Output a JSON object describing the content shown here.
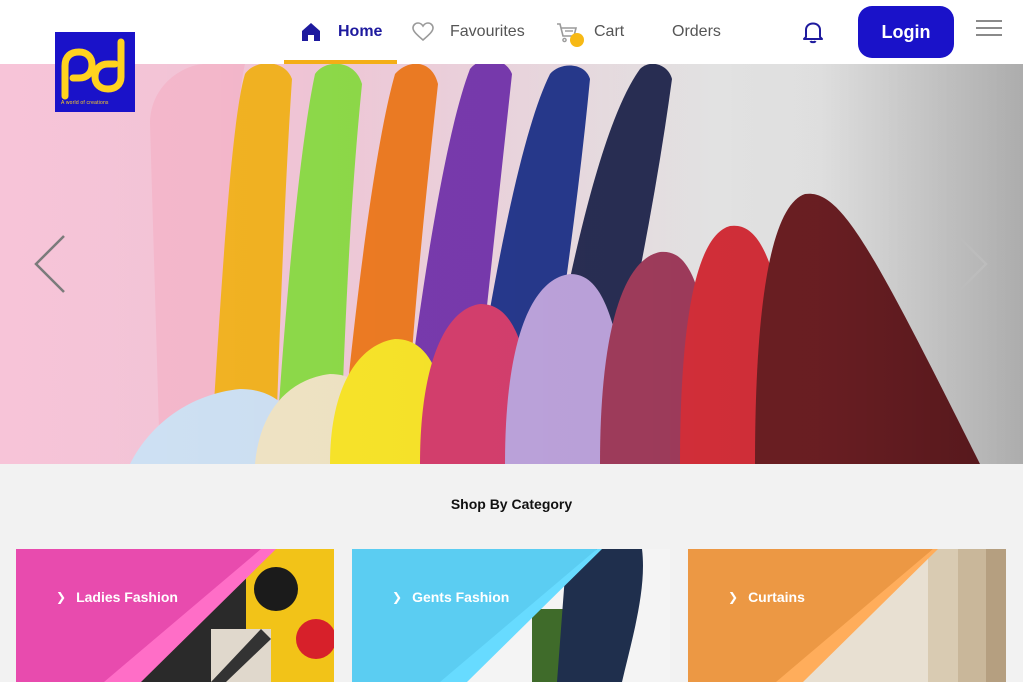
{
  "header": {
    "logo_text": "pd",
    "logo_tagline": "A world of creations",
    "nav": [
      {
        "label": "Home",
        "icon": "home-icon",
        "active": true
      },
      {
        "label": "Favourites",
        "icon": "heart-icon"
      },
      {
        "label": "Cart",
        "icon": "cart-icon"
      },
      {
        "label": "Orders"
      }
    ],
    "login_label": "Login"
  },
  "colors": {
    "brand": "#1a12c9",
    "accent": "#f4ae17",
    "ladies": "#e84bae",
    "gents": "#5bcdf2",
    "curtains": "#ec9844"
  },
  "hero": {
    "icons": [
      "chevron-left-icon",
      "chevron-right-icon"
    ]
  },
  "categories_section": {
    "title": "Shop By Category",
    "items": [
      {
        "label": "Ladies Fashion"
      },
      {
        "label": "Gents Fashion"
      },
      {
        "label": "Curtains"
      }
    ]
  }
}
